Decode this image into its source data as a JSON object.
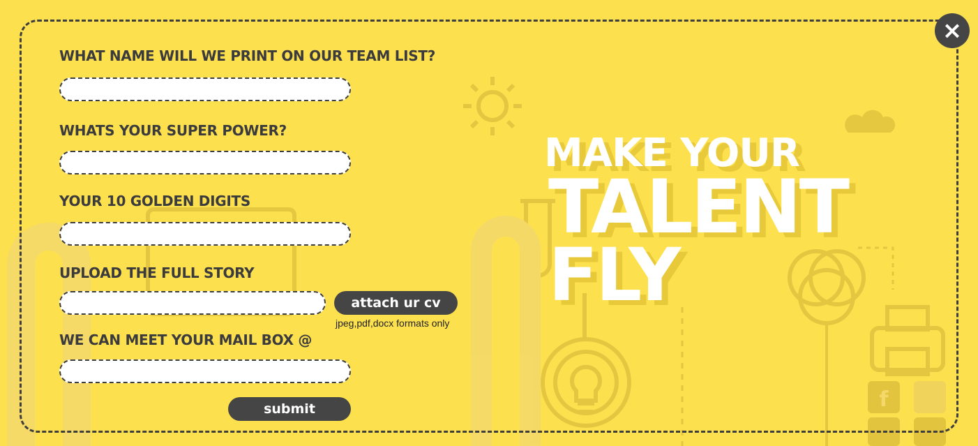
{
  "form": {
    "name_label": "WHAT NAME WILL WE PRINT ON OUR TEAM LIST?",
    "name_value": "",
    "power_label": "WHATS YOUR SUPER POWER?",
    "power_value": "",
    "phone_label": "YOUR 10 GOLDEN DIGITS",
    "phone_value": "",
    "upload_label": "UPLOAD THE FULL STORY",
    "upload_value": "",
    "attach_label": "attach ur cv",
    "formats_hint": "jpeg,pdf,docx formats only",
    "email_label": "WE CAN MEET YOUR MAIL BOX @",
    "email_value": "",
    "submit_label": "submit"
  },
  "close": {
    "label": "×",
    "icon": "close-icon"
  },
  "headline": {
    "line1": "MAKE YOUR",
    "line2": "TALENT",
    "line3": "FLY"
  },
  "colors": {
    "background": "#fde04e",
    "accent_dark": "#454546",
    "text_dark": "#3b3b3d",
    "headline": "#ffffff"
  }
}
